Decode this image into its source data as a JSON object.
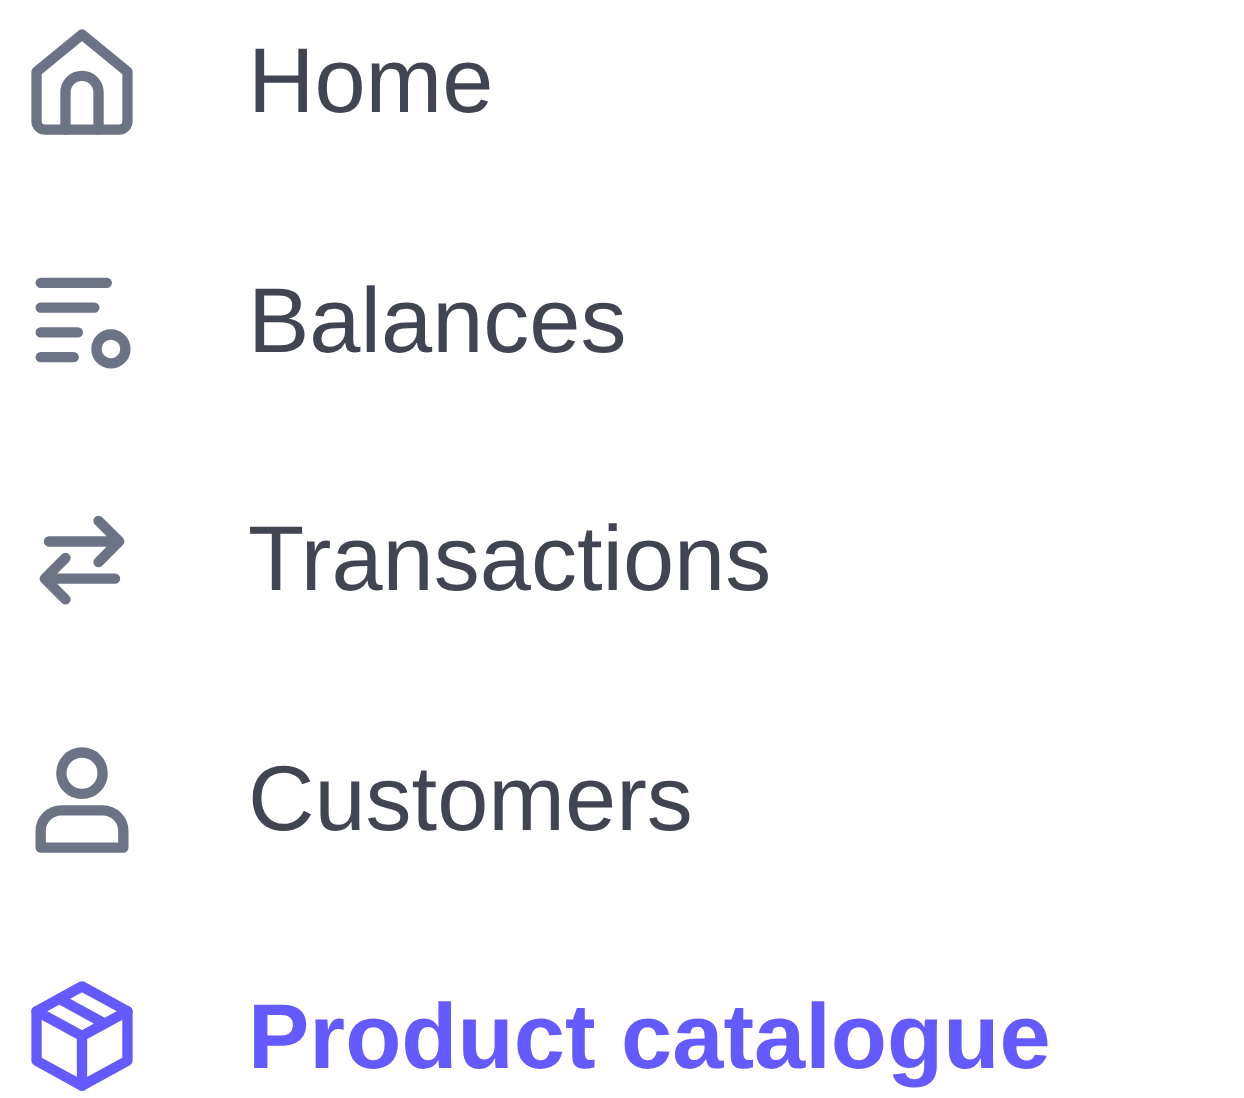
{
  "nav_items": [
    {
      "label": "Home",
      "selected": false
    },
    {
      "label": "Balances",
      "selected": false
    },
    {
      "label": "Transactions",
      "selected": false
    },
    {
      "label": "Customers",
      "selected": false
    },
    {
      "label": "Product catalogue",
      "selected": true
    }
  ]
}
